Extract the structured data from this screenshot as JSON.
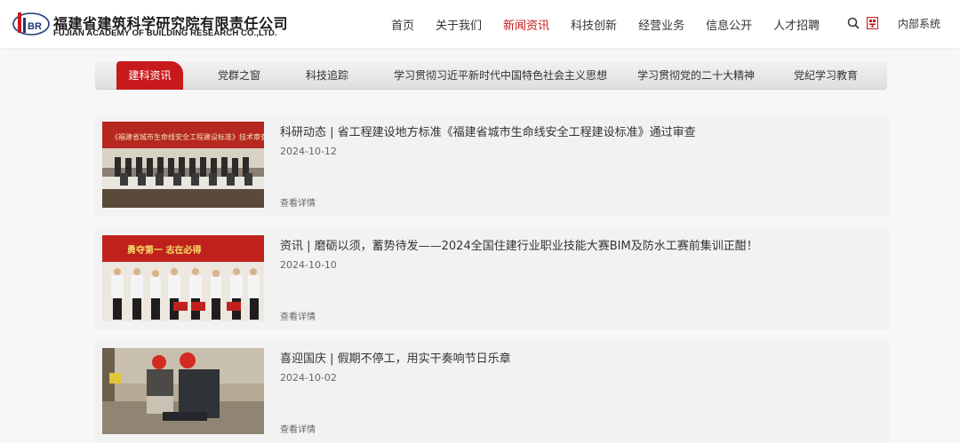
{
  "logo": {
    "mark_text": "BR",
    "name_cn": "福建省建筑科学研究院有限责任公司",
    "name_en": "FUJIAN ACADEMY OF BUILDING RESEARCH CO.,LTD."
  },
  "nav": {
    "items": [
      {
        "label": "首页"
      },
      {
        "label": "关于我们"
      },
      {
        "label": "新闻资讯",
        "active": true
      },
      {
        "label": "科技创新"
      },
      {
        "label": "经营业务"
      },
      {
        "label": "信息公开"
      },
      {
        "label": "人才招聘"
      }
    ],
    "internal_label": "内部系统"
  },
  "tabs": [
    {
      "label": "建科资讯",
      "active": true
    },
    {
      "label": "党群之窗"
    },
    {
      "label": "科技追踪"
    },
    {
      "label": "学习贯彻习近平新时代中国特色社会主义思想"
    },
    {
      "label": "学习贯彻党的二十大精神"
    },
    {
      "label": "党纪学习教育"
    }
  ],
  "news": [
    {
      "title": "科研动态 | 省工程建设地方标准《福建省城市生命线安全工程建设标准》通过审查",
      "date": "2024-10-12",
      "more": "查看详情",
      "banner_text": "《福建省城市生命线安全工程建设标准》技术审查会"
    },
    {
      "title": "资讯 | 磨砺以须，蓄势待发——2024全国住建行业职业技能大赛BIM及防水工赛前集训正酣！",
      "date": "2024-10-10",
      "more": "查看详情",
      "banner_text": "勇夺第一  志在必得"
    },
    {
      "title": "喜迎国庆 | 假期不停工，用实干奏响节日乐章",
      "date": "2024-10-02",
      "more": "查看详情"
    }
  ],
  "colors": {
    "accent": "#c8191c",
    "page_bg": "#f7f7f7",
    "card_bg": "#f2f2f2"
  }
}
